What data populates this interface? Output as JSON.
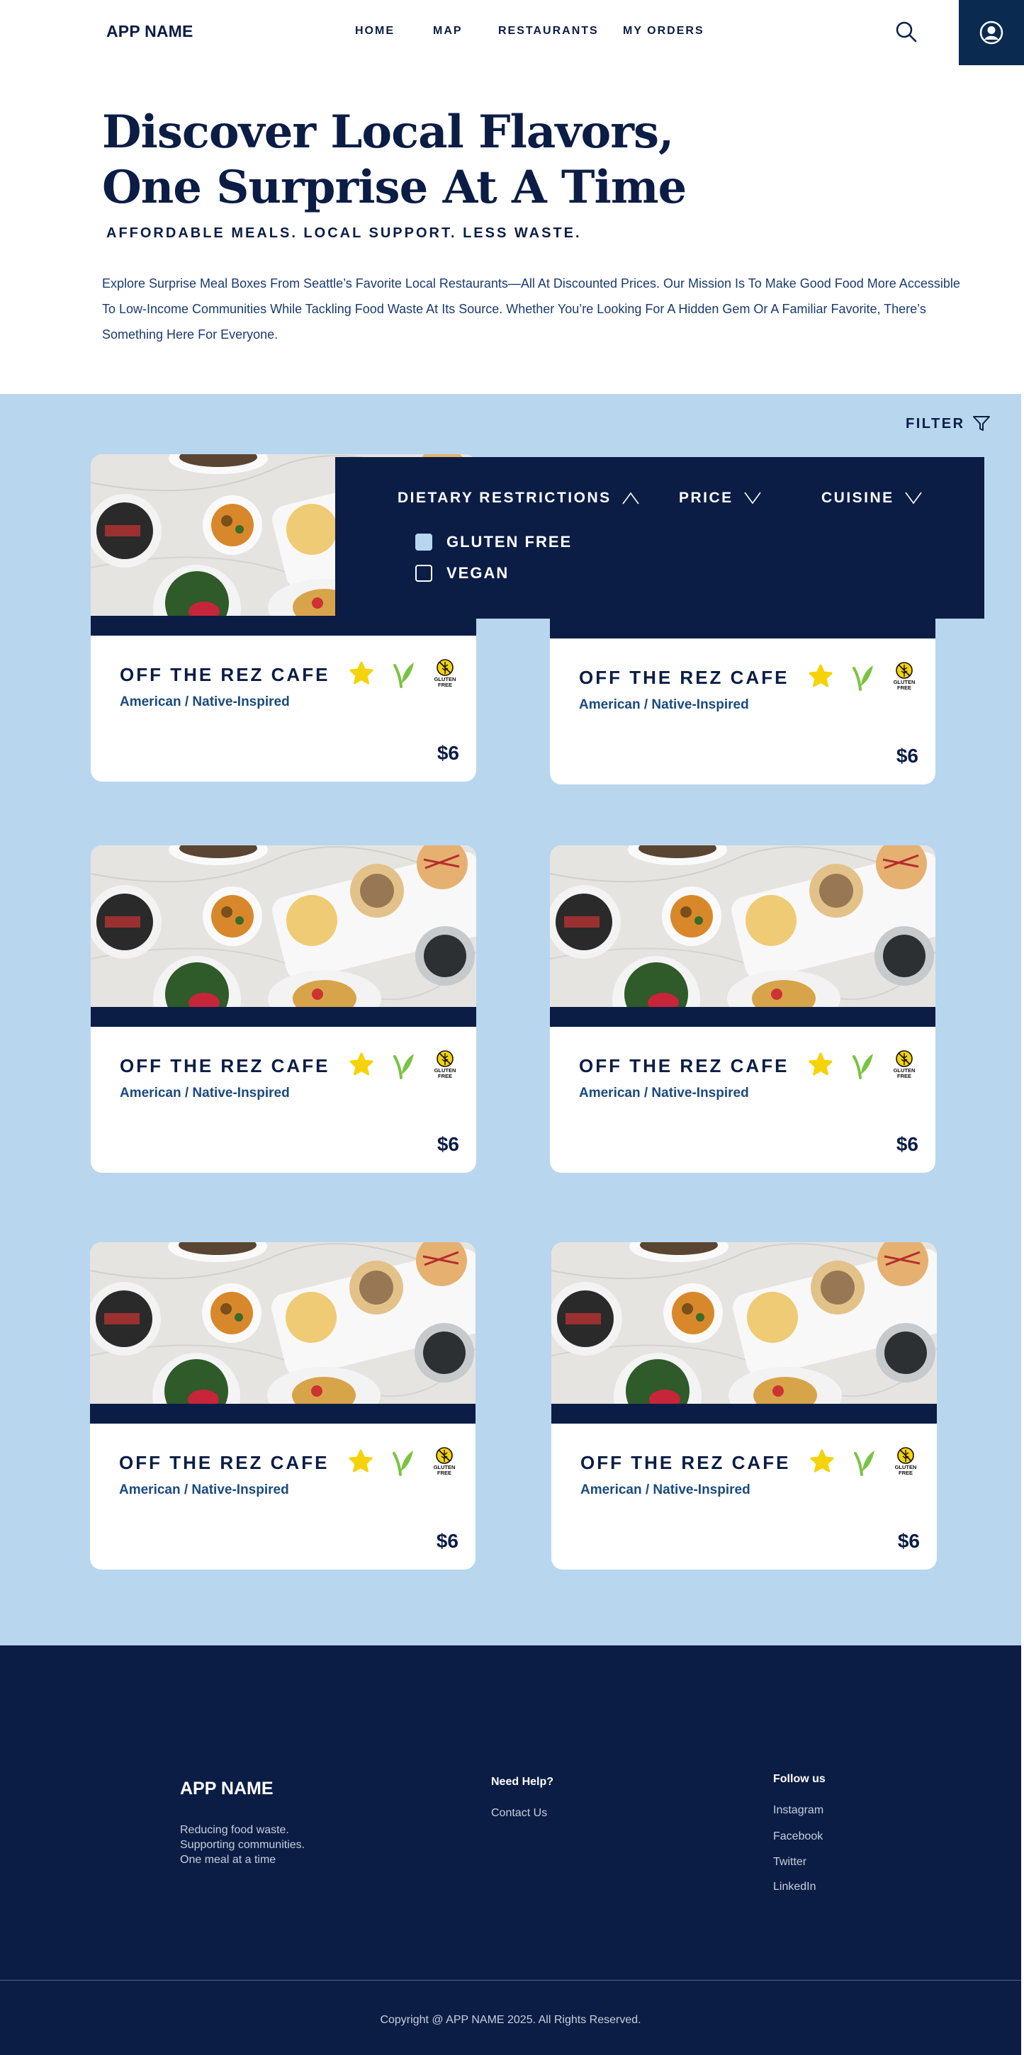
{
  "header": {
    "app_name": "APP NAME",
    "nav": [
      "HOME",
      "MAP",
      "RESTAURANTS",
      "MY ORDERS"
    ],
    "search_icon": "search-icon",
    "profile_icon": "user-circle-icon",
    "profile_bg": "#0a2a50"
  },
  "hero": {
    "title_line1": "Discover Local Flavors,",
    "title_line2": "One Surprise At A Time",
    "subtitle": "AFFORDABLE MEALS. LOCAL SUPPORT. LESS WASTE.",
    "description": "Explore Surprise Meal Boxes From Seattle’s Favorite Local Restaurants—All At Discounted Prices. Our Mission Is To Make Good Food More Accessible To Low-Income Communities While Tackling Food Waste At Its Source. Whether You’re Looking For A Hidden Gem Or A Familiar Favorite, There’s Something Here For Everyone."
  },
  "listing": {
    "filter_label": "FILTER",
    "bg": "#b9d6ef",
    "cards": [
      {
        "name": "OFF THE REZ CAFE",
        "cuisine": "American / Native-Inspired",
        "price": "$6",
        "tags": [
          "star-icon",
          "vegan-leaf-icon",
          "gluten-free-icon"
        ]
      },
      {
        "name": "OFF THE REZ CAFE",
        "cuisine": "American / Native-Inspired",
        "price": "$6",
        "tags": [
          "star-icon",
          "vegan-leaf-icon",
          "gluten-free-icon"
        ]
      },
      {
        "name": "OFF THE REZ CAFE",
        "cuisine": "American / Native-Inspired",
        "price": "$6",
        "tags": [
          "star-icon",
          "vegan-leaf-icon",
          "gluten-free-icon"
        ]
      },
      {
        "name": "OFF THE REZ CAFE",
        "cuisine": "American / Native-Inspired",
        "price": "$6",
        "tags": [
          "star-icon",
          "vegan-leaf-icon",
          "gluten-free-icon"
        ]
      },
      {
        "name": "OFF THE REZ CAFE",
        "cuisine": "American / Native-Inspired",
        "price": "$6",
        "tags": [
          "star-icon",
          "vegan-leaf-icon",
          "gluten-free-icon"
        ]
      },
      {
        "name": "OFF THE REZ CAFE",
        "cuisine": "American / Native-Inspired",
        "price": "$6",
        "tags": [
          "star-icon",
          "vegan-leaf-icon",
          "gluten-free-icon"
        ]
      }
    ],
    "gluten_badge_text": "GLUTEN FREE"
  },
  "filter_dropdown": {
    "dietary_label": "DIETARY RESTRICTIONS",
    "price_label": "PRICE",
    "cuisine_label": "CUISINE",
    "options": [
      {
        "label": "GLUTEN FREE",
        "checked": true
      },
      {
        "label": "VEGAN",
        "checked": false
      }
    ]
  },
  "footer": {
    "app_name": "APP NAME",
    "tagline": [
      "Reducing food waste.",
      "Supporting communities.",
      "One meal at a time"
    ],
    "help_heading": "Need Help?",
    "help_links": [
      "Contact Us"
    ],
    "follow_heading": "Follow us",
    "social_links": [
      "Instagram",
      "Facebook",
      "Twitter",
      "LinkedIn"
    ],
    "copyright": "Copyright @ APP NAME 2025. All Rights Reserved."
  },
  "colors": {
    "navy": "#0b1d45",
    "accent_blue": "#b9d6ef",
    "star": "#f5d30b",
    "leaf": "#7cc242"
  }
}
